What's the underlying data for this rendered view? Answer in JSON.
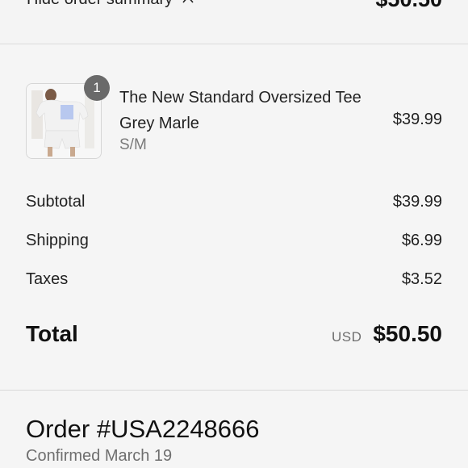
{
  "summary_toggle": {
    "label": "Hide order summary",
    "icon": "chevron-up-icon",
    "total": "$50.50"
  },
  "product": {
    "quantity": "1",
    "name": "The New Standard Oversized Tee Grey Marle",
    "variant": "S/M",
    "price": "$39.99"
  },
  "costs": {
    "subtotal_label": "Subtotal",
    "subtotal_value": "$39.99",
    "shipping_label": "Shipping",
    "shipping_value": "$6.99",
    "taxes_label": "Taxes",
    "taxes_value": "$3.52"
  },
  "total": {
    "label": "Total",
    "currency": "USD",
    "value": "$50.50"
  },
  "order": {
    "number": "Order #USA2248666",
    "status": "Confirmed March 19"
  }
}
